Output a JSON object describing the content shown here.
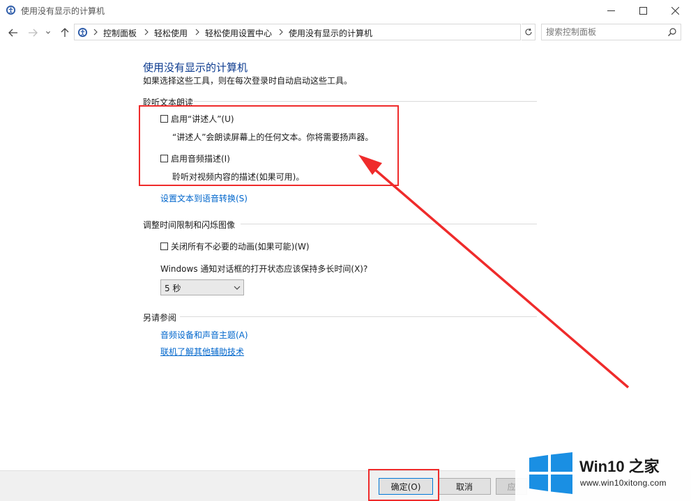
{
  "window": {
    "title": "使用没有显示的计算机"
  },
  "address_bar": {
    "crumbs": [
      "控制面板",
      "轻松使用",
      "轻松使用设置中心",
      "使用没有显示的计算机"
    ]
  },
  "search": {
    "placeholder": "搜索控制面板"
  },
  "main": {
    "heading": "使用没有显示的计算机",
    "subtext": "如果选择这些工具，则在每次登录时自动启动这些工具。",
    "sections": {
      "listen": {
        "title": "聆听文本朗读",
        "narrator_label": "启用“讲述人”(U)",
        "narrator_desc": "“讲述人”会朗读屏幕上的任何文本。你将需要扬声器。",
        "audio_desc_label": "启用音频描述(I)",
        "audio_desc_desc": "聆听对视频内容的描述(如果可用)。",
        "tts_link": "设置文本到语音转换(S)"
      },
      "timing": {
        "title": "调整时间限制和闪烁图像",
        "animations_label": "关闭所有不必要的动画(如果可能)(W)",
        "notify_question": "Windows 通知对话框的打开状态应该保持多长时间(X)?",
        "duration_value": "5 秒"
      },
      "see_also": {
        "title": "另请参阅",
        "audio_link": "音频设备和声音主题(A)",
        "online_link": "联机了解其他辅助技术"
      }
    }
  },
  "footer": {
    "ok_label": "确定(O)",
    "cancel_label": "取消",
    "apply_label": "应"
  },
  "watermark": {
    "brand_a": "Win10",
    "brand_b": "之家",
    "url": "www.win10xitong.com"
  },
  "colors": {
    "accent_link": "#0066cc",
    "heading": "#0b3a8f",
    "annotation_red": "#ef2b2b",
    "win_blue": "#1a8fe3"
  }
}
